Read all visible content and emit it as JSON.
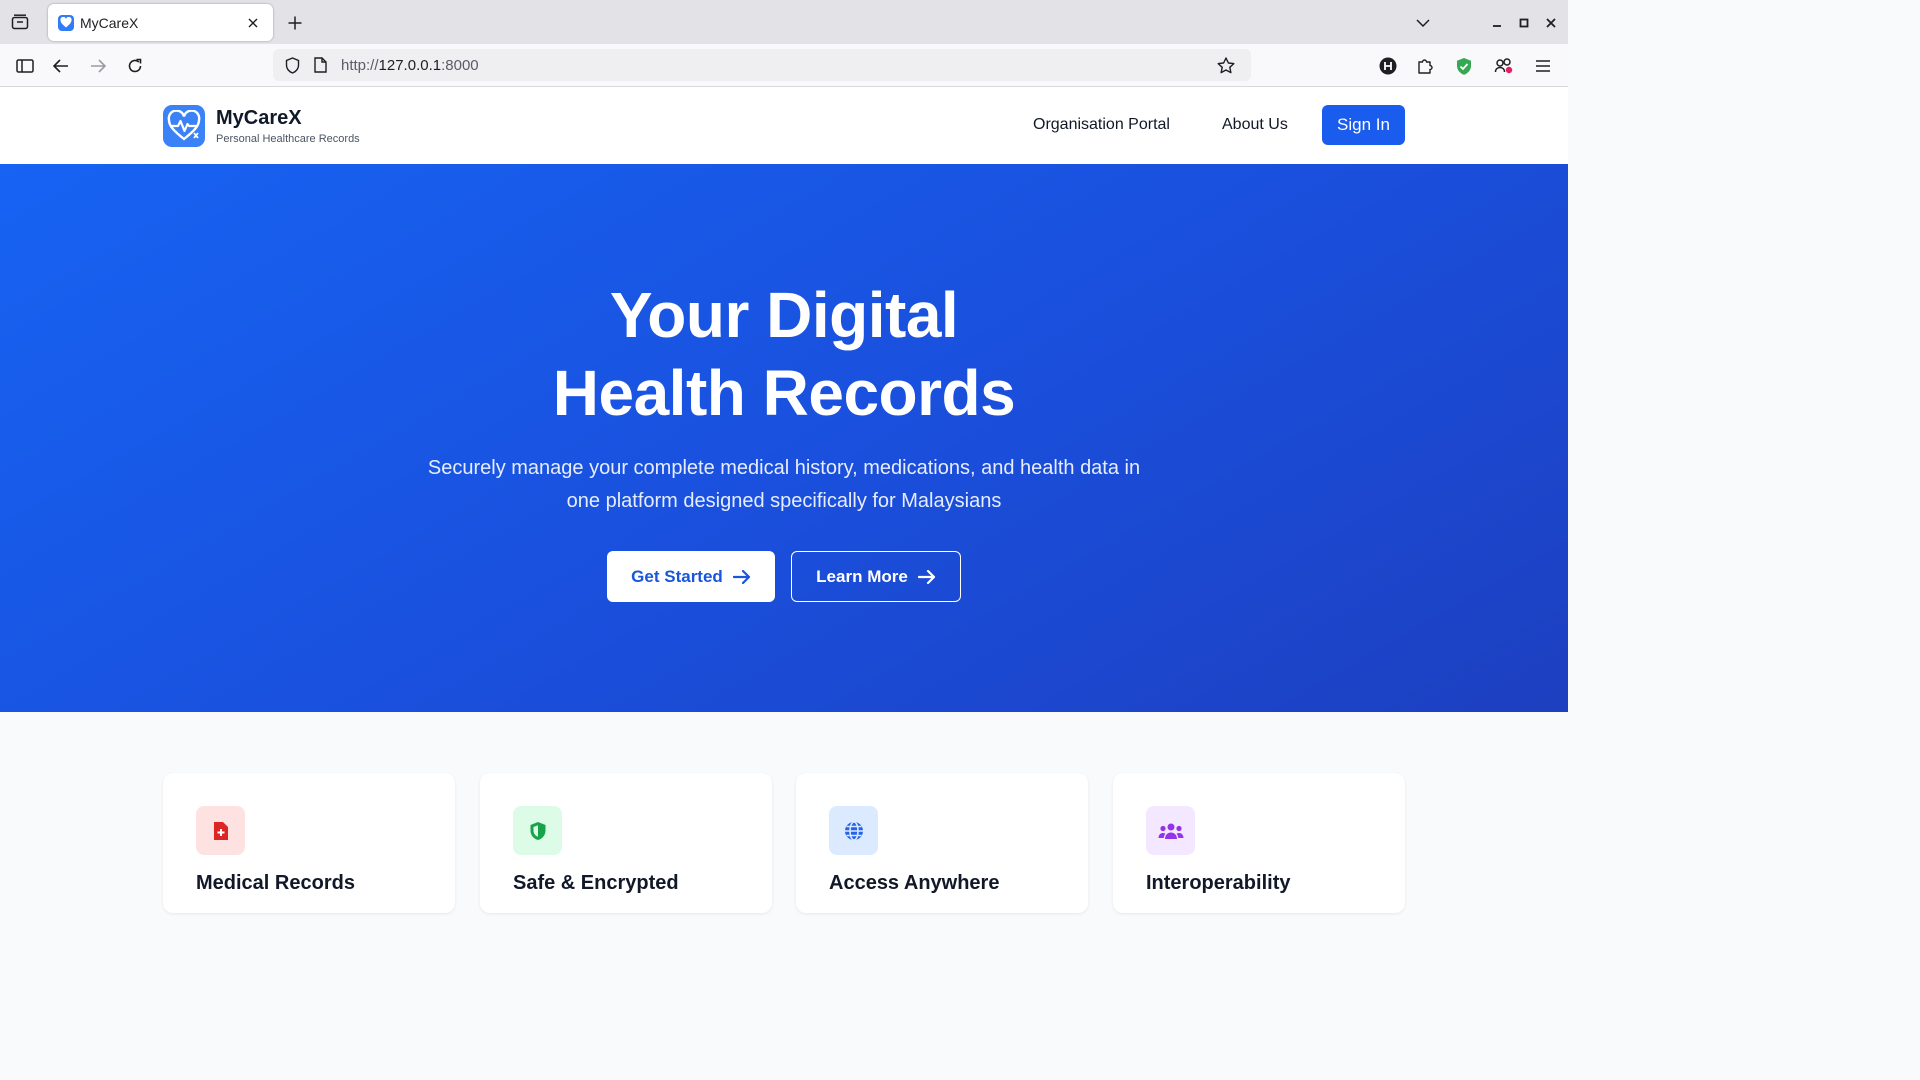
{
  "browser": {
    "tab_title": "MyCareX",
    "url_prefix": "http://",
    "url_host": "127.0.0.1",
    "url_suffix": ":8000"
  },
  "header": {
    "brand_name": "MyCareX",
    "brand_tagline": "Personal Healthcare Records",
    "nav": {
      "organisation_portal": "Organisation Portal",
      "about_us": "About Us",
      "sign_in": "Sign In"
    }
  },
  "hero": {
    "title_line1": "Your Digital",
    "title_line2": "Health Records",
    "subtitle_line1": "Securely manage your complete medical history, medications, and health data in",
    "subtitle_line2": "one platform designed specifically for Malaysians",
    "get_started": "Get Started",
    "learn_more": "Learn More"
  },
  "features": [
    {
      "title": "Medical Records",
      "icon": "medical-file-icon",
      "icon_bg": "#fee2e2",
      "icon_color": "#dc2626"
    },
    {
      "title": "Safe & Encrypted",
      "icon": "shield-icon",
      "icon_bg": "#dcfce7",
      "icon_color": "#16a34a"
    },
    {
      "title": "Access Anywhere",
      "icon": "globe-icon",
      "icon_bg": "#dbeafe",
      "icon_color": "#2563eb"
    },
    {
      "title": "Interoperability",
      "icon": "users-icon",
      "icon_bg": "#f3e8ff",
      "icon_color": "#9333ea"
    }
  ],
  "colors": {
    "brand_blue": "#1a5ced",
    "hero_start": "#1763f3",
    "hero_end": "#1d3fc0"
  }
}
